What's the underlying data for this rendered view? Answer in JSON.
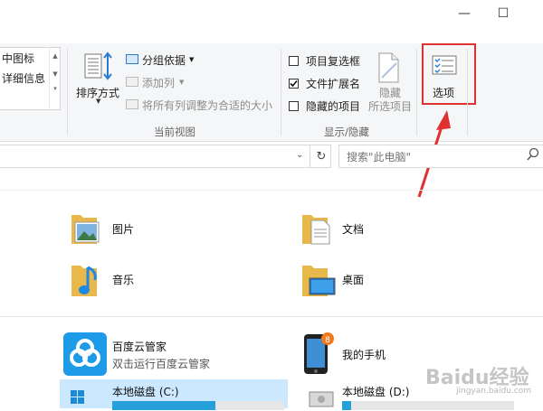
{
  "window": {
    "minimize_glyph": "—",
    "maximize_glyph": "☐"
  },
  "layout_group": {
    "items": [
      "中图标",
      "详细信息"
    ]
  },
  "current_view": {
    "sort_label": "排序方式",
    "group_by": "分组依据",
    "add_column": "添加列",
    "fit_columns": "将所有列调整为合适的大小",
    "group_label": "当前视图"
  },
  "show_hide": {
    "item_checkboxes": {
      "label": "项目复选框",
      "checked": false
    },
    "file_extensions": {
      "label": "文件扩展名",
      "checked": true
    },
    "hidden_items": {
      "label": "隐藏的项目",
      "checked": false
    },
    "hide_selected": [
      "隐藏",
      "所选项目"
    ],
    "group_label": "显示/隐藏"
  },
  "options": {
    "label": "选项"
  },
  "search": {
    "placeholder": "搜索\"此电脑\""
  },
  "folders": [
    {
      "name": "图片"
    },
    {
      "name": "文档"
    },
    {
      "name": "音乐"
    },
    {
      "name": "桌面"
    }
  ],
  "apps": [
    {
      "name": "百度云管家",
      "sub": "双击运行百度云管家"
    },
    {
      "name": "我的手机"
    }
  ],
  "drives": [
    {
      "name": "本地磁盘 (C:)",
      "used_fraction": 0.6
    },
    {
      "name": "本地磁盘 (D:)",
      "used_fraction": 0.05
    }
  ],
  "watermark": {
    "text": "Baidu经验",
    "url": "jingyan.baidu.com"
  },
  "colors": {
    "highlight_red": "#e03131",
    "drive_bar": "#26a0da",
    "selection": "#cce8ff"
  }
}
